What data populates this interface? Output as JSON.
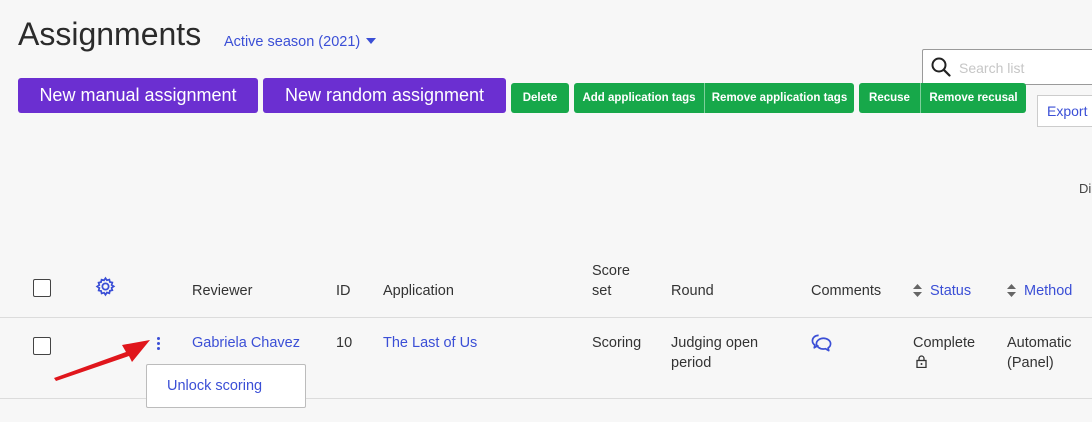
{
  "page": {
    "title": "Assignments",
    "season_selector": "Active season (2021)"
  },
  "search": {
    "placeholder": "Search list"
  },
  "toolbar": {
    "new_manual": "New manual assignment",
    "new_random": "New random assignment",
    "delete": "Delete",
    "add_tags": "Add application tags",
    "remove_tags": "Remove application tags",
    "recuse": "Recuse",
    "remove_recusal": "Remove recusal",
    "export": "Export",
    "cutoff_text": "Di"
  },
  "table": {
    "headers": {
      "reviewer": "Reviewer",
      "id": "ID",
      "application": "Application",
      "score_set_1": "Score",
      "score_set_2": "set",
      "round": "Round",
      "comments": "Comments",
      "status": "Status",
      "method": "Method"
    },
    "rows": [
      {
        "reviewer": "Gabriela Chavez",
        "id": "10",
        "application": "The Last of Us",
        "score_set": "Scoring",
        "round_1": "Judging open",
        "round_2": "period",
        "status": "Complete",
        "method_1": "Automatic",
        "method_2": "(Panel)"
      }
    ]
  },
  "row_menu": {
    "unlock_scoring": "Unlock scoring"
  },
  "colors": {
    "primary_purple": "#6b2fd1",
    "action_green": "#17a84a",
    "link_blue": "#3b4fd6",
    "arrow_red": "#e0161c"
  }
}
